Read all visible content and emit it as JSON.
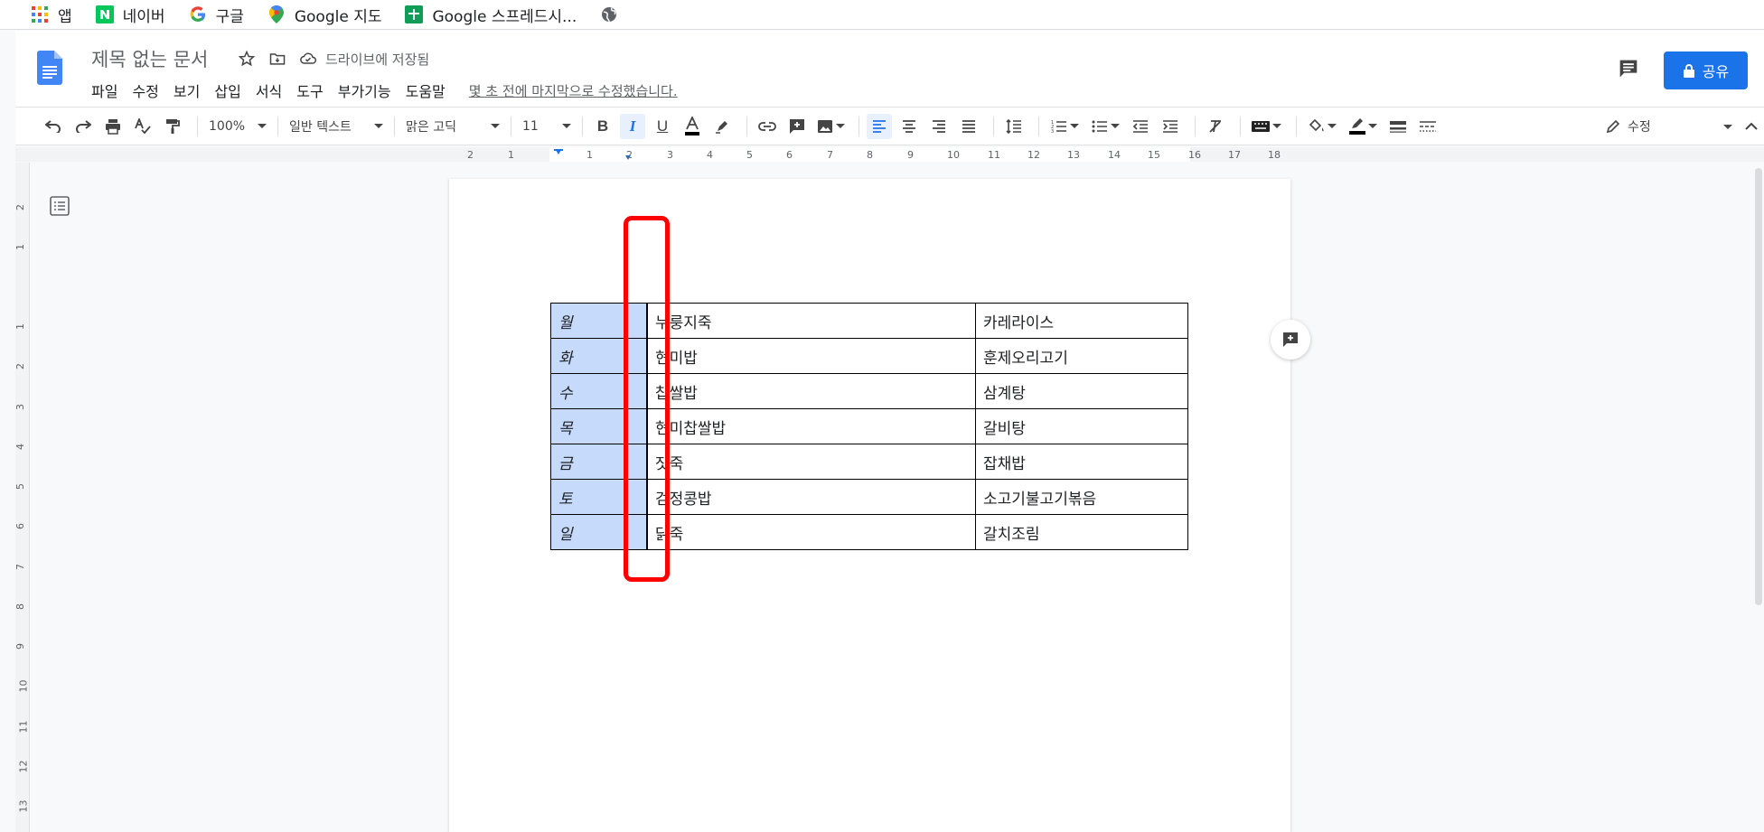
{
  "bookmarks": [
    {
      "label": "앱",
      "icon": "apps-grid-icon"
    },
    {
      "label": "네이버",
      "icon": "naver-icon"
    },
    {
      "label": "구글",
      "icon": "google-icon"
    },
    {
      "label": "Google 지도",
      "icon": "google-maps-icon"
    },
    {
      "label": "Google 스프레드시...",
      "icon": "google-sheets-icon"
    },
    {
      "label": "",
      "icon": "globe-icon"
    }
  ],
  "header": {
    "title": "제목 없는 문서",
    "saved_status": "드라이브에 저장됨",
    "last_edit": "몇 초 전에 마지막으로 수정했습니다.",
    "share_label": "공유"
  },
  "menu": [
    "파일",
    "수정",
    "보기",
    "삽입",
    "서식",
    "도구",
    "부가기능",
    "도움말"
  ],
  "toolbar": {
    "zoom": "100%",
    "style": "일반 텍스트",
    "font": "맑은 고딕",
    "font_size": "11",
    "mode": "수정",
    "text_color": "#000000",
    "accent": "#1a73e8"
  },
  "ruler": {
    "h_ticks": [
      "2",
      "1",
      "1",
      "2",
      "3",
      "4",
      "5",
      "6",
      "7",
      "8",
      "9",
      "10",
      "11",
      "12",
      "13",
      "14",
      "15",
      "16",
      "17",
      "18"
    ],
    "v_ticks": [
      "2",
      "1",
      "1",
      "2",
      "3",
      "4",
      "5",
      "6",
      "7",
      "8",
      "9",
      "10",
      "11",
      "12",
      "13"
    ]
  },
  "table": {
    "rows": [
      {
        "day": "월",
        "lunch": "누룽지죽",
        "dinner": "카레라이스"
      },
      {
        "day": "화",
        "lunch": "현미밥",
        "dinner": "훈제오리고기"
      },
      {
        "day": "수",
        "lunch": "찹쌀밥",
        "dinner": "삼계탕"
      },
      {
        "day": "목",
        "lunch": "현미찹쌀밥",
        "dinner": "갈비탕"
      },
      {
        "day": "금",
        "lunch": "잣죽",
        "dinner": "잡채밥"
      },
      {
        "day": "토",
        "lunch": "검정콩밥",
        "dinner": "소고기불고기볶음"
      },
      {
        "day": "일",
        "lunch": "닭죽",
        "dinner": "갈치조림"
      }
    ]
  }
}
